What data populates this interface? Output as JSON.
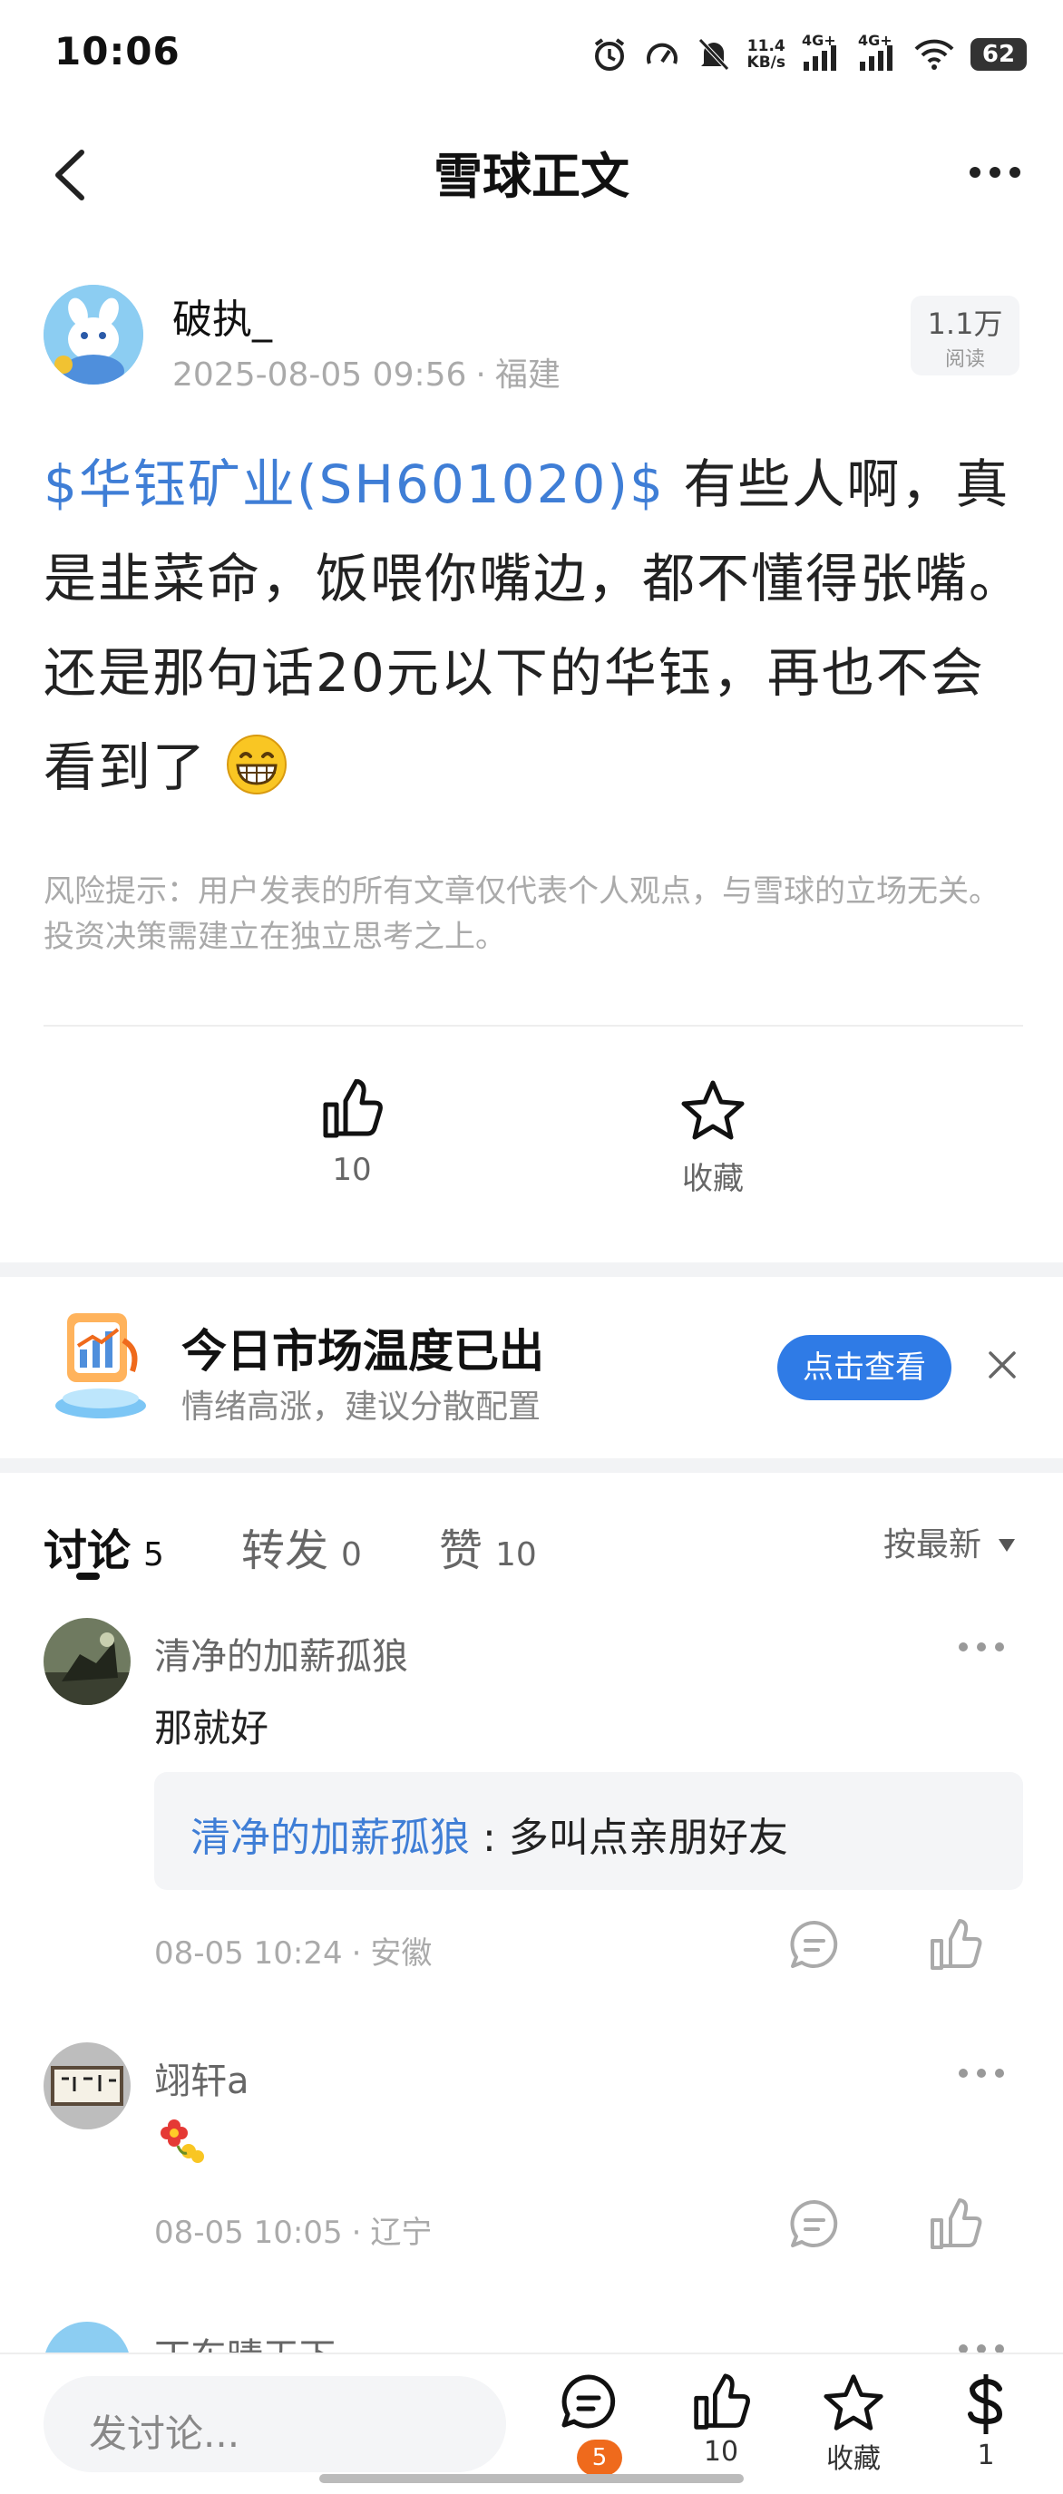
{
  "status": {
    "time": "10:06",
    "net_speed_value": "11.4",
    "net_speed_unit": "KB/s",
    "signal1": "4G+",
    "signal2": "4G+",
    "battery": "62"
  },
  "nav": {
    "title": "雪球正文"
  },
  "post": {
    "author": "破执_",
    "datetime": "2025-08-05 09:56",
    "location": "福建",
    "views_count": "1.1万",
    "views_label": "阅读",
    "stock_link": "$华钰矿业(SH601020)$",
    "body": " 有些人啊，真是韭菜命，饭喂你嘴边，都不懂得张嘴。还是那句话20元以下的华钰，再也不会看到了",
    "risk_notice": "风险提示：用户发表的所有文章仅代表个人观点，与雪球的立场无关。投资决策需建立在独立思考之上。"
  },
  "actions": {
    "like_count": "10",
    "favorite_label": "收藏"
  },
  "promo": {
    "title": "今日市场温度已出",
    "subtitle": "情绪高涨，建议分散配置",
    "button": "点击查看"
  },
  "tabs": [
    {
      "label": "讨论",
      "count": "5"
    },
    {
      "label": "转发",
      "count": "0"
    },
    {
      "label": "赞",
      "count": "10"
    }
  ],
  "sort_label": "按最新",
  "comments": [
    {
      "user": "清净的加薪孤狼",
      "text": "那就好",
      "quote_user": "清净的加薪孤狼",
      "quote_sep": ":",
      "quote_text": "多叫点亲朋好友",
      "time": "08-05 10:24",
      "location": "安徽"
    },
    {
      "user": "翊轩a",
      "text": "",
      "time": "08-05 10:05",
      "location": "辽宁"
    },
    {
      "user": "丁东晴天下"
    }
  ],
  "bottom": {
    "input_placeholder": "发讨论...",
    "comment_badge": "5",
    "like_count": "10",
    "favorite_label": "收藏",
    "reward_count": "1"
  },
  "colors": {
    "accent": "#3f7ed6",
    "button": "#2f7be6",
    "badge": "#ef6a1c"
  }
}
